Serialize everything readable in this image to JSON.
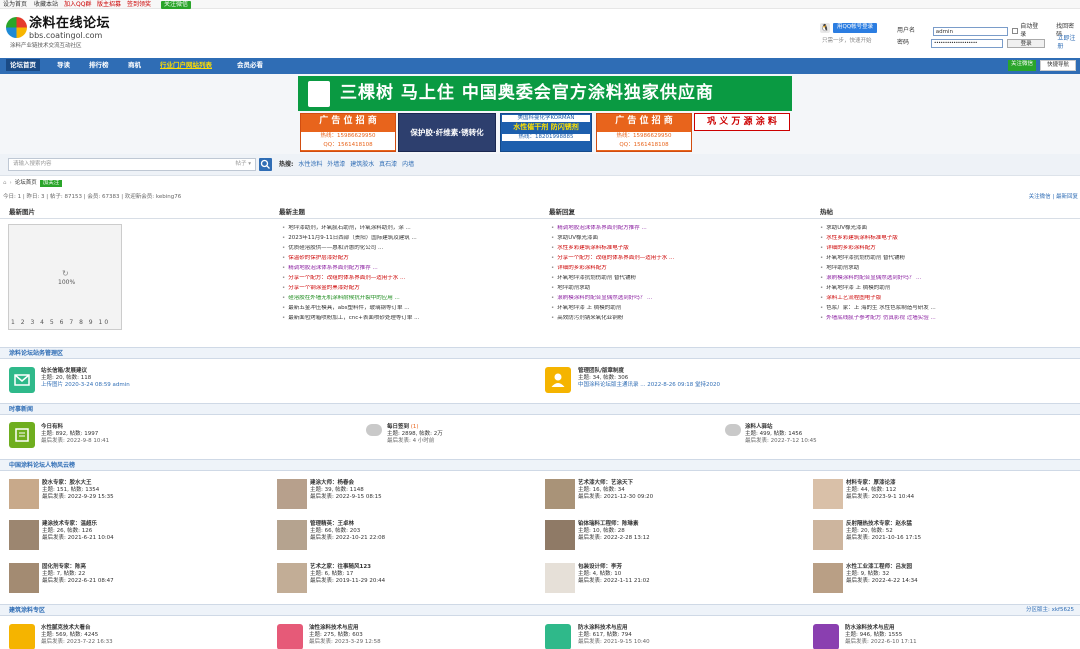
{
  "topbar": {
    "home": "设为首页",
    "fav": "收藏本站",
    "qq": "加入QQ群",
    "recruit": "版主招募",
    "signin": "签到领奖",
    "wechat": "关注微信"
  },
  "header": {
    "title": "涂料在线论坛",
    "url": "bbs.coatingol.com",
    "slogan": "涂料产业链技术交流互动社区",
    "qq_btn": "用QQ帐号登录",
    "qq_hint": "只需一步，快速开始",
    "user_label": "用户名",
    "user_value": "admin",
    "pwd_label": "密码",
    "pwd_value": "••••••••••••••••••••",
    "auto_login": "自动登录",
    "login_btn": "登录",
    "find_pwd": "找回密码",
    "register": "立即注册"
  },
  "nav": {
    "items": [
      "论坛首页",
      "导读",
      "排行榜",
      "商机",
      "行业门户网站列表",
      "会员必看"
    ],
    "wechat": "关注微信",
    "quick": "快捷导航"
  },
  "ads": {
    "banner": "三棵树 马上住 中国奥委会官方涂料独家供应商",
    "box1_title": "广 告 位 招 商",
    "box1_line1": "热线：15986629950",
    "box1_line2": "QQ：1561418108",
    "box2_title": "保护胶·纤维素·锈转化",
    "box3_title": "美国科曼化学KORMAN",
    "box3_sub": "水性催干剂 防闪锈剂",
    "box3_tel": "热线：18201998885",
    "box4_title": "广 告 位 招 商",
    "box4_line1": "热线：15986629950",
    "box4_line2": "QQ：1561418108",
    "box5_title": "巩 义 万 源 涂 料"
  },
  "search": {
    "placeholder": "请输入搜索内容",
    "type": "帖子 ▾",
    "hot_label": "热搜:",
    "keywords": [
      "水性涂料",
      "外墙漆",
      "建筑胶水",
      "真石漆",
      "内墙"
    ]
  },
  "crumb": {
    "home": "论坛首页",
    "follow": "加关注"
  },
  "stats": {
    "text": "今日: 1 | 昨日: 3 | 帖子: 87153 | 会员: 67383 | 欢迎新会员: kebing76",
    "right": "关注微信 | 最新回复"
  },
  "cols": {
    "pics": "最新图片",
    "topics": "最新主题",
    "replies": "最新回复",
    "hot": "热帖"
  },
  "slide": {
    "pct": "100%",
    "nums": "1 2 3 4 5 6 7 8 9 10"
  },
  "topics": [
    {
      "t": "地坪漆助剂，环氧腻石助剂，环氧涂料助剂，涂 ...",
      "c": ""
    },
    {
      "t": "2023年11月9-11日西部（贵阳）国际建筑及建筑 ...",
      "c": ""
    },
    {
      "t": "优质硅溶胶供——惠和济惠的化公司 ...",
      "c": ""
    },
    {
      "t": "保温砂的保护层漆好配方",
      "c": "c-red"
    },
    {
      "t": "精调地胶泡沫体系界面剂配方推荐 ...",
      "c": "c-purple"
    },
    {
      "t": "分享一个配方：改组的体系界面剂—适用于水 ...",
      "c": "c-red"
    },
    {
      "t": "分享一个钢涂金的黑漆好配方",
      "c": "c-red"
    },
    {
      "t": "硅溶胶在外墙无机涂料耐候抗开裂中的应用 ...",
      "c": "c-green"
    },
    {
      "t": "最新五金冲压模具，abs塑料件，玻璃钢等订单 ...",
      "c": ""
    },
    {
      "t": "最新面包烤箱喷粉加工，cnc+表面喷砂处理等订单 ...",
      "c": ""
    }
  ],
  "replies": [
    {
      "t": "精调地胶泡沫体系界面剂配方推荐 ...",
      "c": "c-purple"
    },
    {
      "t": "求助UV橡光漆面",
      "c": ""
    },
    {
      "t": "水性乡彩建筑涂料标准电子版",
      "c": "c-red"
    },
    {
      "t": "分享一个配方：改组的体系界面剂—适用于水 ...",
      "c": "c-red"
    },
    {
      "t": "详细的乡彩涂料配方",
      "c": "c-red"
    },
    {
      "t": "环氧地坪漆抗划伤助剂 替代铺粉",
      "c": ""
    },
    {
      "t": "地坪助剂求助",
      "c": ""
    },
    {
      "t": "滚刷模涂料的配合显偶然选到好吗？ ...",
      "c": "c-purple"
    },
    {
      "t": "环氧地坪漆 上 稠模的助剂",
      "c": ""
    },
    {
      "t": "高效防污剂钠米氧化亚铜粉",
      "c": ""
    }
  ],
  "hot": [
    {
      "t": "求助UV橡光漆面",
      "c": ""
    },
    {
      "t": "水性乡彩建筑涂料标准电子版",
      "c": "c-red"
    },
    {
      "t": "详细的乡彩涂料配方",
      "c": "c-red"
    },
    {
      "t": "环氧地坪漆抗划伤助剂 替代铺粉",
      "c": ""
    },
    {
      "t": "地坪助剂求助",
      "c": ""
    },
    {
      "t": "滚刷模涂料的配合显偶然选到好吗？ ...",
      "c": "c-purple"
    },
    {
      "t": "环氧地坪漆 上 稠模的助剂",
      "c": ""
    },
    {
      "t": "涂料工艺流程图电子版",
      "c": "c-red"
    },
    {
      "t": "色浆厂家：上 海的生 水性色浆制造与研发 ...",
      "c": ""
    },
    {
      "t": "外墙底线腻子参考配方 仿真影视 过墙实验 ...",
      "c": "c-purple"
    }
  ],
  "sections": {
    "s1": "涂料论坛站务管理区",
    "s2": "时事新闻",
    "s3": "中国涂料论坛人物风云榜",
    "s4": "建筑涂料专区",
    "s4_right": "分区版主: xkf5625"
  },
  "s1": [
    {
      "name": "站长信箱/发展建议",
      "meta": "主题: 20, 帖数: 118",
      "last": "上传图片 2020-3-24 08:59 admin"
    },
    {
      "name": "管理团队/版章制度",
      "meta": "主题: 34, 帖数: 306",
      "last": "中国涂料论坛版主通讯录 ... 2022-8-26 09:18 堂持2020"
    }
  ],
  "s2": [
    {
      "name": "今日有料",
      "meta": "主题: 892, 帖数: 1997",
      "last": "最后发表: 2022-9-8 10:41"
    },
    {
      "name": "每日签到",
      "badge": "(1)",
      "meta": "主题: 2898, 帖数: 2万",
      "last": "最后发表: 4 小时前"
    },
    {
      "name": "涂料人驿站",
      "meta": "主题: 499, 帖数: 1456",
      "last": "最后发表: 2022-7-12 10:45"
    }
  ],
  "people": [
    {
      "name": "胶水专家：胶水大王",
      "meta": "主题: 151, 帖数: 1354",
      "last": "最后发表: 2022-9-29 15:35"
    },
    {
      "name": "建涂大师：杨春会",
      "meta": "主题: 39, 帖数: 1148",
      "last": "最后发表: 2022-9-15 08:15"
    },
    {
      "name": "艺术漆大师：艺涂天下",
      "meta": "主题: 16, 帖数: 34",
      "last": "最后发表: 2021-12-30 09:20"
    },
    {
      "name": "材料专家：厚漆论漆",
      "meta": "主题: 44, 帖数: 112",
      "last": "最后发表: 2023-9-1 10:44"
    },
    {
      "name": "建涂技术专家：温超乐",
      "meta": "主题: 26, 帖数: 126",
      "last": "最后发表: 2021-6-21 10:04"
    },
    {
      "name": "管理精英：王卓林",
      "meta": "主题: 66, 帖数: 203",
      "last": "最后发表: 2022-10-21 22:08"
    },
    {
      "name": "铂体瑞料工程师：陈琳素",
      "meta": "主题: 10, 帖数: 28",
      "last": "最后发表: 2022-2-28 13:12"
    },
    {
      "name": "反射隔热技术专家：赵永猛",
      "meta": "主题: 20, 帖数: 52",
      "last": "最后发表: 2021-10-16 17:15"
    },
    {
      "name": "固化剂专家：陈亮",
      "meta": "主题: 7, 帖数: 22",
      "last": "最后发表: 2022-6-21 08:47"
    },
    {
      "name": "艺术之家：往事随风123",
      "meta": "主题: 6, 帖数: 17",
      "last": "最后发表: 2019-11-29 20:44"
    },
    {
      "name": "包装设计师：李芳",
      "meta": "主题: 4, 帖数: 10",
      "last": "最后发表: 2022-1-11 21:02"
    },
    {
      "name": "水性工业漆工程师：吕友园",
      "meta": "主题: 9, 帖数: 32",
      "last": "最后发表: 2022-4-22 14:34"
    }
  ],
  "s4": [
    {
      "name": "水性腻克技术大看台",
      "meta": "主题: 569, 帖数: 4245",
      "last": "最后发表: 2023-7-22 16:33"
    },
    {
      "name": "油性涂料技术与应用",
      "meta": "主题: 275, 帖数: 603",
      "last": "最后发表: 2023-3-29 12:58"
    },
    {
      "name": "防水涂料技术与应用",
      "meta": "主题: 617, 帖数: 794",
      "last": "最后发表: 2021-9-15 10:40"
    },
    {
      "name": "防水涂料技术与应用",
      "meta": "主题: 946, 帖数: 1555",
      "last": "最后发表: 2022-6-10 17:11"
    }
  ]
}
